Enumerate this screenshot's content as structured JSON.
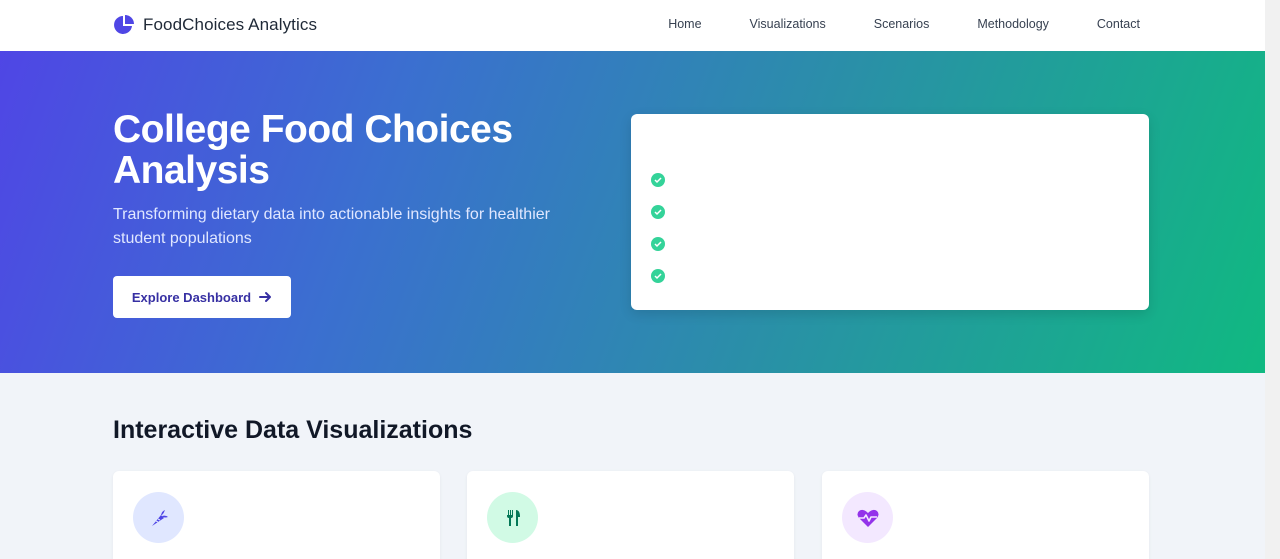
{
  "nav": {
    "brand": "FoodChoices Analytics",
    "links": [
      "Home",
      "Visualizations",
      "Scenarios",
      "Methodology",
      "Contact"
    ]
  },
  "hero": {
    "title": "College Food Choices Analysis",
    "subtitle": "Transforming dietary data into actionable insights for healthier student populations",
    "cta_label": "Explore Dashboard",
    "card_items_count_visible": 4
  },
  "visualizations": {
    "section_title": "Interactive Data Visualizations",
    "cards": [
      {
        "icon": "carrot-icon",
        "color": "#4f46e5",
        "bg": "#e0e7ff"
      },
      {
        "icon": "utensils-icon",
        "color": "#047857",
        "bg": "#d1fae5"
      },
      {
        "icon": "heartbeat-icon",
        "color": "#9333ea",
        "bg": "#f3e8ff"
      }
    ]
  },
  "colors": {
    "primary": "#4f46e5",
    "accent": "#10b981"
  }
}
